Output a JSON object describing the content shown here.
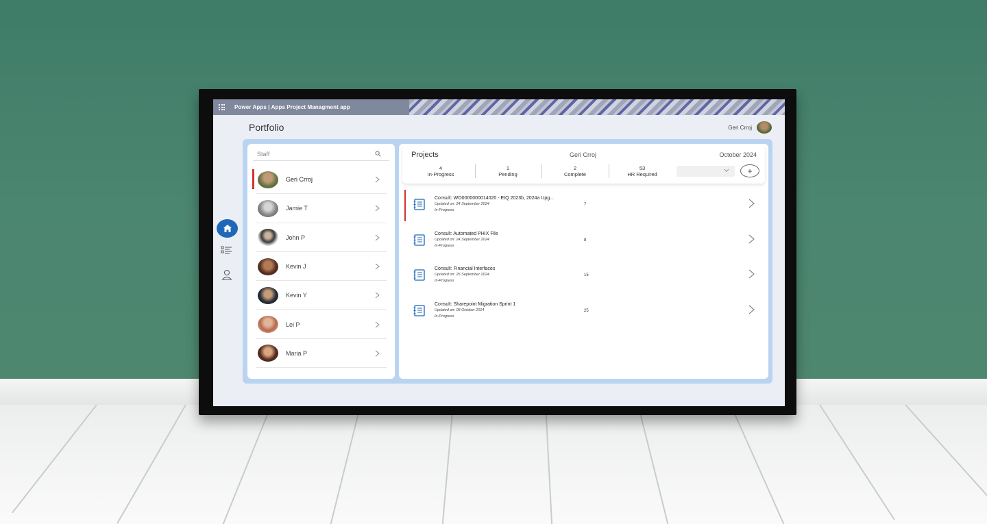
{
  "app": {
    "title": "Power Apps  |  Apps Project Managment app"
  },
  "header": {
    "page_title": "Portfolio",
    "user_name": "Geri Crroj"
  },
  "nav": {
    "items": [
      {
        "name": "home",
        "icon": "home-icon",
        "active": true
      },
      {
        "name": "list",
        "icon": "list-icon",
        "active": false
      },
      {
        "name": "profile",
        "icon": "person-icon",
        "active": false
      }
    ],
    "active_color": "#1f68b8"
  },
  "staff": {
    "search_placeholder": "Staff",
    "members": [
      {
        "name": "Geri Crroj",
        "selected": true
      },
      {
        "name": "Jamie T",
        "selected": false
      },
      {
        "name": "John P",
        "selected": false
      },
      {
        "name": "Kevin J",
        "selected": false
      },
      {
        "name": "Kevin Y",
        "selected": false
      },
      {
        "name": "Lei P",
        "selected": false
      },
      {
        "name": "Maria P",
        "selected": false
      }
    ]
  },
  "projects": {
    "title": "Projects",
    "user": "Geri Crroj",
    "month": "October 2024",
    "stats": [
      {
        "value": "4",
        "label": "In-Progress"
      },
      {
        "value": "1",
        "label": "Pending"
      },
      {
        "value": "2",
        "label": "Complete"
      },
      {
        "value": "53",
        "label": "HR Required"
      }
    ],
    "add_label": "+",
    "items": [
      {
        "name": "Consult: WO0000000014020 - EtQ  2023b, 2024a Upg...",
        "updated": "Updated on: 24 September 2024",
        "status": "In-Progress",
        "count": "7",
        "selected": true
      },
      {
        "name": "Consult: Automated PHIX File",
        "updated": "Updated on: 24 September 2024",
        "status": "In-Progress",
        "count": "8",
        "selected": false
      },
      {
        "name": "Consult: Financial Interfaces",
        "updated": "Updated on: 25 September 2024",
        "status": "In-Progress",
        "count": "15",
        "selected": false
      },
      {
        "name": "Consult: Sharepoint Migration Sprint 1",
        "updated": "Updated on: 08 October 2024",
        "status": "In-Progress",
        "count": "25",
        "selected": false
      }
    ]
  },
  "colors": {
    "accent": "#1f68b8",
    "selection": "#d43131",
    "frame": "#b9d4f1"
  }
}
